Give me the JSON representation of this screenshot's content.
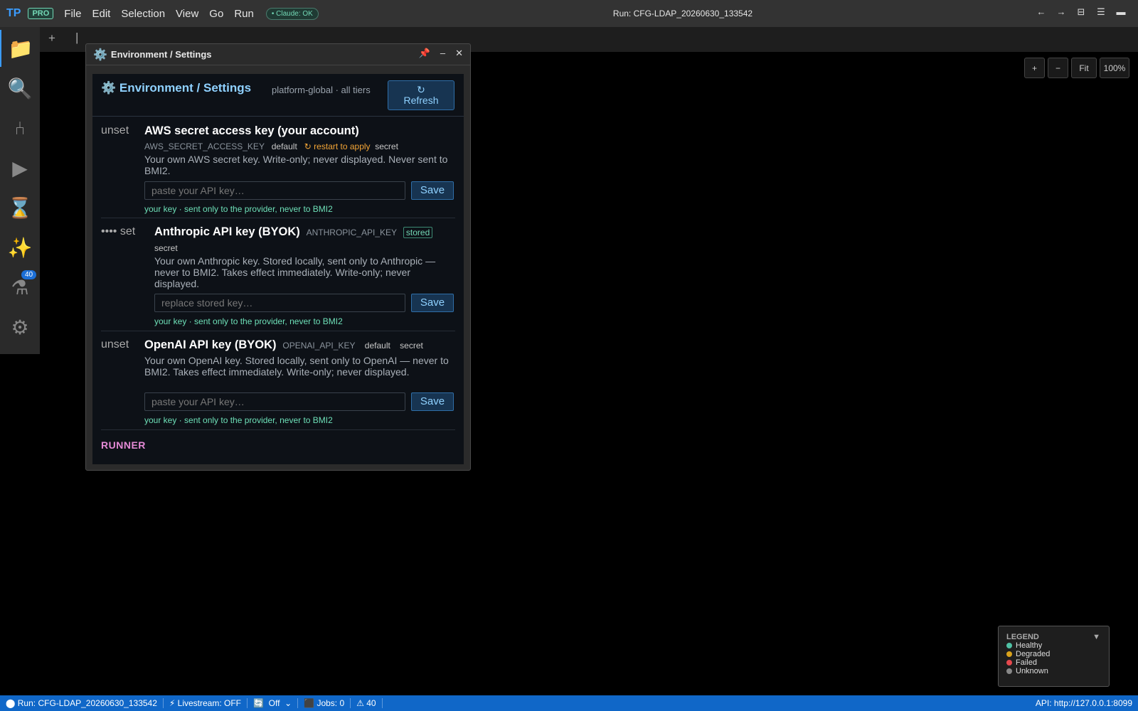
{
  "app": {
    "logo": "TP",
    "pro_badge": "PRO",
    "menus": [
      "File",
      "Edit",
      "Selection",
      "View",
      "Go",
      "Run"
    ],
    "claude_status": "• Claude: OK",
    "run_title": "Run: CFG-LDAP_20260630_133542",
    "title_controls": [
      "←",
      "→",
      "⊟",
      "☰",
      "▬"
    ]
  },
  "activity_bar": {
    "items": [
      {
        "name": "explorer",
        "glyph": "📁"
      },
      {
        "name": "search",
        "glyph": "🔍"
      },
      {
        "name": "source-control",
        "glyph": "⑃"
      },
      {
        "name": "run",
        "glyph": "▶"
      },
      {
        "name": "history",
        "glyph": "⌛"
      },
      {
        "name": "ai",
        "glyph": "✨"
      },
      {
        "name": "flask",
        "glyph": "⚗",
        "badge": "40"
      },
      {
        "name": "settings",
        "glyph": "⚙"
      }
    ]
  },
  "tabstrip": {
    "add": "+",
    "separator": "|"
  },
  "zoom": {
    "plus": "+",
    "minus": "−",
    "fit": "Fit",
    "level": "100%"
  },
  "panel": {
    "window_title": "Environment / Settings",
    "icon": "⚙️",
    "controls": {
      "pin": "📌",
      "minimize": "–",
      "close": "✕"
    },
    "header": {
      "title": "Environment / Settings",
      "scope": "platform-global · all tiers",
      "refresh_icon": "↻",
      "refresh_label": "Refresh"
    },
    "settings": [
      {
        "status": "unset",
        "name": "AWS secret access key (your account)",
        "env": "AWS_SECRET_ACCESS_KEY",
        "source": "default",
        "restart_note": "↻ restart to apply",
        "kind": "secret",
        "description": "Your own AWS secret key. Write-only; never displayed. Never sent to BMI2.",
        "placeholder": "paste your API key…",
        "save_label": "Save",
        "hint": "your key · sent only to the provider, never to BMI2"
      },
      {
        "status": "•••• set",
        "name": "Anthropic API key (BYOK)",
        "env": "ANTHROPIC_API_KEY",
        "source": "stored",
        "kind": "secret",
        "description": "Your own Anthropic key. Stored locally, sent only to Anthropic — never to BMI2. Takes effect immediately. Write-only; never displayed.",
        "placeholder": "replace stored key…",
        "save_label": "Save",
        "hint": "your key · sent only to the provider, never to BMI2"
      },
      {
        "status": "unset",
        "name": "OpenAI API key (BYOK)",
        "env": "OPENAI_API_KEY",
        "source": "default",
        "kind": "secret",
        "description": "Your own OpenAI key. Stored locally, sent only to OpenAI — never to BMI2. Takes effect immediately. Write-only; never displayed.",
        "placeholder": "paste your API key…",
        "save_label": "Save",
        "hint": "your key · sent only to the provider, never to BMI2"
      }
    ],
    "section_runner": "RUNNER"
  },
  "legend": {
    "title": "LEGEND",
    "toggle": "▼",
    "items": [
      {
        "label": "Healthy",
        "color": "#4fc1a4"
      },
      {
        "label": "Degraded",
        "color": "#d9a21b"
      },
      {
        "label": "Failed",
        "color": "#e5484d"
      },
      {
        "label": "Unknown",
        "color": "#888888"
      }
    ]
  },
  "statusbar": {
    "run": "⬤ Run: CFG-LDAP_20260630_133542",
    "livestream": "⚡ Livestream: OFF",
    "refresh_icon": "🔄",
    "refresh_mode": "Off",
    "jobs": "⬛ Jobs: 0",
    "warnings": "⚠ 40",
    "api": "API: http://127.0.0.1:8099"
  },
  "colors": {
    "accent": "#3b9cff",
    "statusbar": "#1067c8",
    "runner_heading": "#e48ad6",
    "hint": "#6ee0b8",
    "warn": "#f3a536"
  }
}
